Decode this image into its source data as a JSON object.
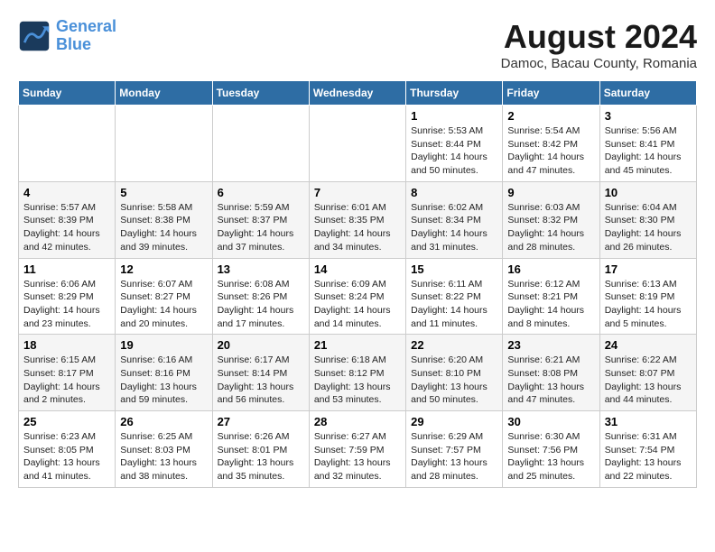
{
  "logo": {
    "line1": "General",
    "line2": "Blue"
  },
  "title": "August 2024",
  "location": "Damoc, Bacau County, Romania",
  "weekdays": [
    "Sunday",
    "Monday",
    "Tuesday",
    "Wednesday",
    "Thursday",
    "Friday",
    "Saturday"
  ],
  "weeks": [
    [
      {
        "day": "",
        "info": ""
      },
      {
        "day": "",
        "info": ""
      },
      {
        "day": "",
        "info": ""
      },
      {
        "day": "",
        "info": ""
      },
      {
        "day": "1",
        "info": "Sunrise: 5:53 AM\nSunset: 8:44 PM\nDaylight: 14 hours\nand 50 minutes."
      },
      {
        "day": "2",
        "info": "Sunrise: 5:54 AM\nSunset: 8:42 PM\nDaylight: 14 hours\nand 47 minutes."
      },
      {
        "day": "3",
        "info": "Sunrise: 5:56 AM\nSunset: 8:41 PM\nDaylight: 14 hours\nand 45 minutes."
      }
    ],
    [
      {
        "day": "4",
        "info": "Sunrise: 5:57 AM\nSunset: 8:39 PM\nDaylight: 14 hours\nand 42 minutes."
      },
      {
        "day": "5",
        "info": "Sunrise: 5:58 AM\nSunset: 8:38 PM\nDaylight: 14 hours\nand 39 minutes."
      },
      {
        "day": "6",
        "info": "Sunrise: 5:59 AM\nSunset: 8:37 PM\nDaylight: 14 hours\nand 37 minutes."
      },
      {
        "day": "7",
        "info": "Sunrise: 6:01 AM\nSunset: 8:35 PM\nDaylight: 14 hours\nand 34 minutes."
      },
      {
        "day": "8",
        "info": "Sunrise: 6:02 AM\nSunset: 8:34 PM\nDaylight: 14 hours\nand 31 minutes."
      },
      {
        "day": "9",
        "info": "Sunrise: 6:03 AM\nSunset: 8:32 PM\nDaylight: 14 hours\nand 28 minutes."
      },
      {
        "day": "10",
        "info": "Sunrise: 6:04 AM\nSunset: 8:30 PM\nDaylight: 14 hours\nand 26 minutes."
      }
    ],
    [
      {
        "day": "11",
        "info": "Sunrise: 6:06 AM\nSunset: 8:29 PM\nDaylight: 14 hours\nand 23 minutes."
      },
      {
        "day": "12",
        "info": "Sunrise: 6:07 AM\nSunset: 8:27 PM\nDaylight: 14 hours\nand 20 minutes."
      },
      {
        "day": "13",
        "info": "Sunrise: 6:08 AM\nSunset: 8:26 PM\nDaylight: 14 hours\nand 17 minutes."
      },
      {
        "day": "14",
        "info": "Sunrise: 6:09 AM\nSunset: 8:24 PM\nDaylight: 14 hours\nand 14 minutes."
      },
      {
        "day": "15",
        "info": "Sunrise: 6:11 AM\nSunset: 8:22 PM\nDaylight: 14 hours\nand 11 minutes."
      },
      {
        "day": "16",
        "info": "Sunrise: 6:12 AM\nSunset: 8:21 PM\nDaylight: 14 hours\nand 8 minutes."
      },
      {
        "day": "17",
        "info": "Sunrise: 6:13 AM\nSunset: 8:19 PM\nDaylight: 14 hours\nand 5 minutes."
      }
    ],
    [
      {
        "day": "18",
        "info": "Sunrise: 6:15 AM\nSunset: 8:17 PM\nDaylight: 14 hours\nand 2 minutes."
      },
      {
        "day": "19",
        "info": "Sunrise: 6:16 AM\nSunset: 8:16 PM\nDaylight: 13 hours\nand 59 minutes."
      },
      {
        "day": "20",
        "info": "Sunrise: 6:17 AM\nSunset: 8:14 PM\nDaylight: 13 hours\nand 56 minutes."
      },
      {
        "day": "21",
        "info": "Sunrise: 6:18 AM\nSunset: 8:12 PM\nDaylight: 13 hours\nand 53 minutes."
      },
      {
        "day": "22",
        "info": "Sunrise: 6:20 AM\nSunset: 8:10 PM\nDaylight: 13 hours\nand 50 minutes."
      },
      {
        "day": "23",
        "info": "Sunrise: 6:21 AM\nSunset: 8:08 PM\nDaylight: 13 hours\nand 47 minutes."
      },
      {
        "day": "24",
        "info": "Sunrise: 6:22 AM\nSunset: 8:07 PM\nDaylight: 13 hours\nand 44 minutes."
      }
    ],
    [
      {
        "day": "25",
        "info": "Sunrise: 6:23 AM\nSunset: 8:05 PM\nDaylight: 13 hours\nand 41 minutes."
      },
      {
        "day": "26",
        "info": "Sunrise: 6:25 AM\nSunset: 8:03 PM\nDaylight: 13 hours\nand 38 minutes."
      },
      {
        "day": "27",
        "info": "Sunrise: 6:26 AM\nSunset: 8:01 PM\nDaylight: 13 hours\nand 35 minutes."
      },
      {
        "day": "28",
        "info": "Sunrise: 6:27 AM\nSunset: 7:59 PM\nDaylight: 13 hours\nand 32 minutes."
      },
      {
        "day": "29",
        "info": "Sunrise: 6:29 AM\nSunset: 7:57 PM\nDaylight: 13 hours\nand 28 minutes."
      },
      {
        "day": "30",
        "info": "Sunrise: 6:30 AM\nSunset: 7:56 PM\nDaylight: 13 hours\nand 25 minutes."
      },
      {
        "day": "31",
        "info": "Sunrise: 6:31 AM\nSunset: 7:54 PM\nDaylight: 13 hours\nand 22 minutes."
      }
    ]
  ]
}
